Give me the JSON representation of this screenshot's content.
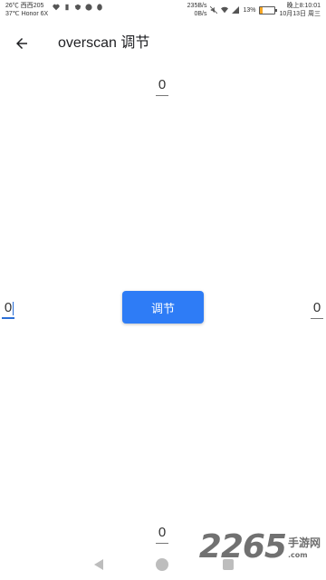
{
  "status_bar": {
    "temp_line1": "26℃ 西西205",
    "temp_line2": "37℃ Honor 6X",
    "net_speed_up": "235B/s",
    "net_speed_down": "0B/s",
    "battery_text": "13%",
    "battery_level": 0.13,
    "time": "晚上8:10:01",
    "date": "10月13日 周三"
  },
  "toolbar": {
    "title": "overscan 调节"
  },
  "fields": {
    "top": "0",
    "left": "0",
    "right": "0",
    "bottom": "0"
  },
  "adjust_button": {
    "label": "调节"
  },
  "watermark": {
    "number": "2265",
    "suffix": ".com",
    "site": "手游网"
  },
  "colors": {
    "accent": "#2e7cf6",
    "focus": "#2b6fd6"
  }
}
